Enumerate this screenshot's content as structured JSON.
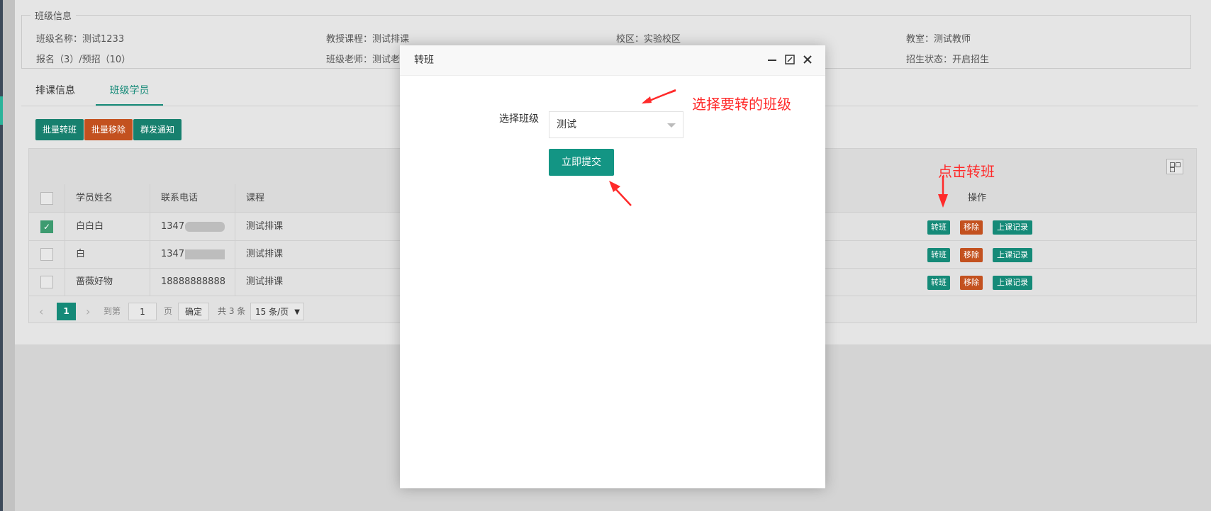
{
  "info": {
    "legend": "班级信息",
    "class_name": "班级名称：测试1233",
    "course": "教授课程：测试排课",
    "campus": "校区：实验校区",
    "classroom": "教室：测试教师",
    "enroll": "报名（3）/预招（10）",
    "teacher": "班级老师：测试老",
    "recruit_status": "招生状态：开启招生"
  },
  "tabs": [
    "排课信息",
    "班级学员"
  ],
  "actions": {
    "batch_transfer": "批量转班",
    "batch_remove": "批量移除",
    "group_notify": "群发通知"
  },
  "table": {
    "headers": {
      "name": "学员姓名",
      "phone": "联系电话",
      "course": "课程",
      "ops": "操作"
    },
    "rows": [
      {
        "name": "白白白",
        "phone": "1347",
        "course": "测试排课",
        "checked": true
      },
      {
        "name": "白",
        "phone": "1347",
        "course": "测试排课",
        "checked": false
      },
      {
        "name": "蔷薇好物",
        "phone": "18888888888",
        "course": "测试排课",
        "checked": false
      }
    ],
    "row_actions": {
      "transfer": "转班",
      "remove": "移除",
      "records": "上课记录"
    }
  },
  "pager": {
    "current": "1",
    "goto": "到第",
    "page_input": "1",
    "page_unit": "页",
    "confirm": "确定",
    "total": "共 3 条",
    "per_page": "15 条/页"
  },
  "modal": {
    "title": "转班",
    "select_label": "选择班级",
    "select_value": "测试",
    "submit": "立即提交"
  },
  "annotations": {
    "select_hint": "选择要转的班级",
    "click_hint": "点击转班"
  },
  "colors": {
    "teal": "#158a78",
    "orange": "#c3511f",
    "annotation_red": "#ff2a2a"
  }
}
